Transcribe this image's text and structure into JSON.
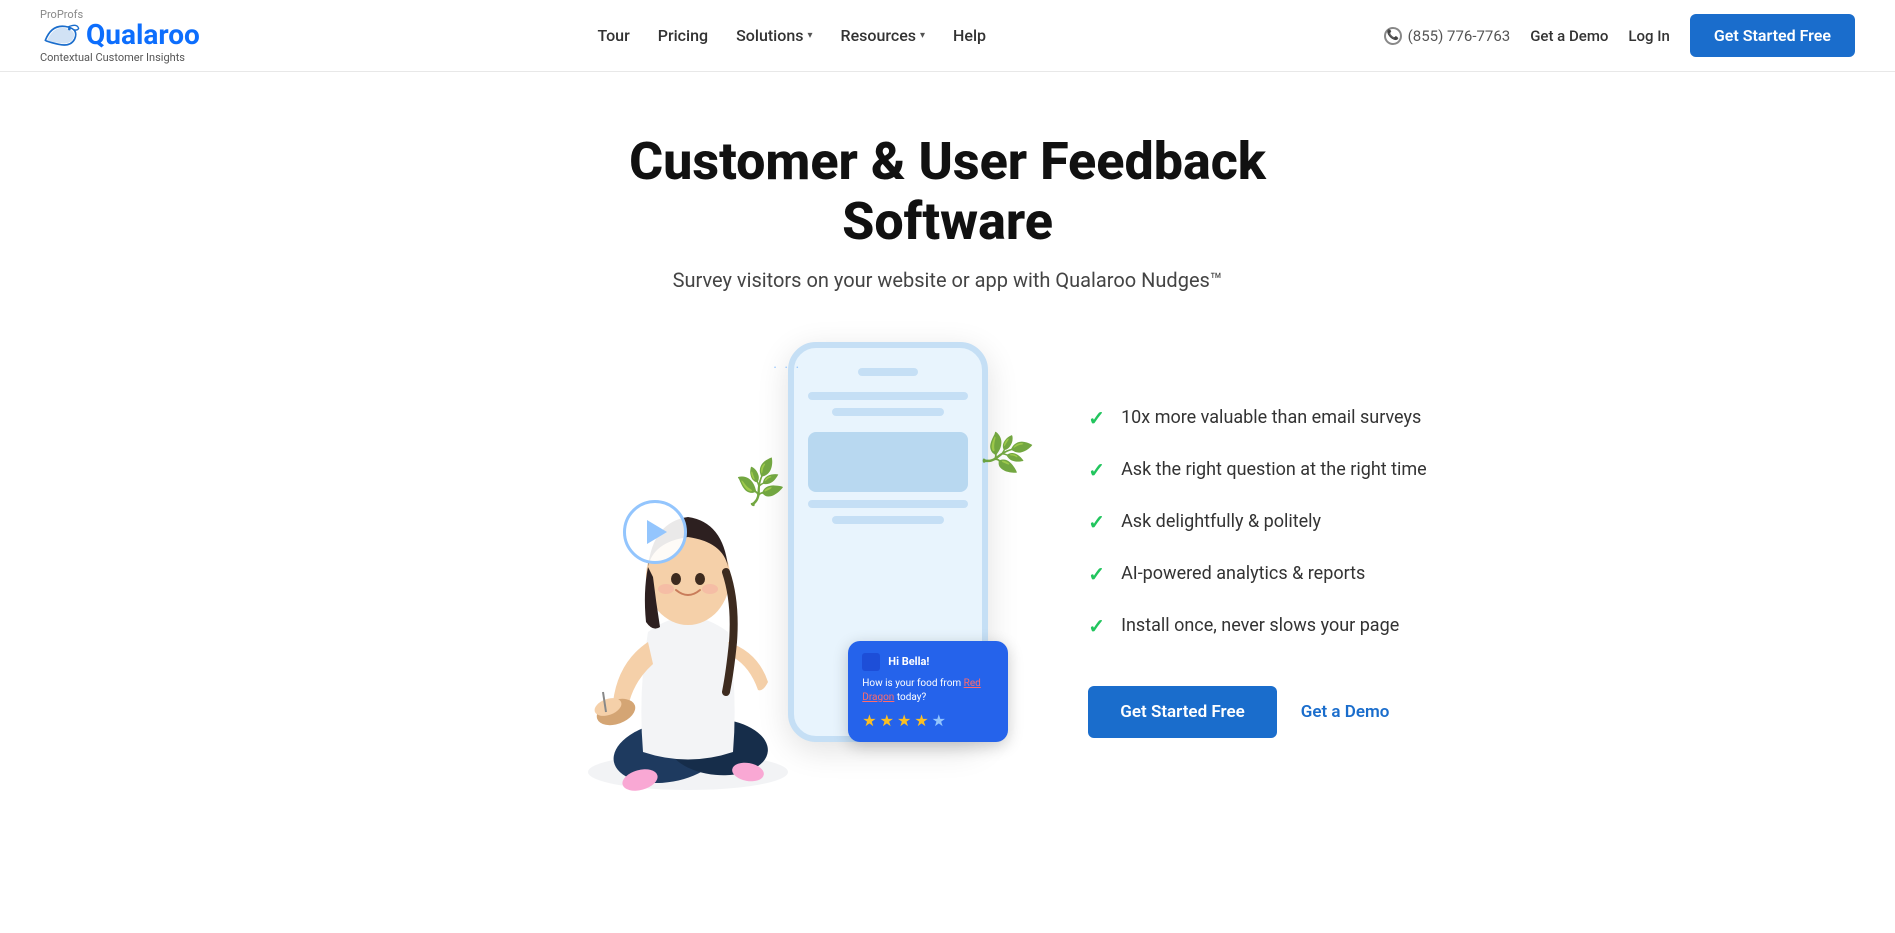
{
  "brand": {
    "proprofs_label": "ProProfs",
    "wordmark": "Qualaroo",
    "tagline": "Contextual Customer Insights"
  },
  "nav": {
    "tour_label": "Tour",
    "pricing_label": "Pricing",
    "solutions_label": "Solutions",
    "resources_label": "Resources",
    "help_label": "Help",
    "phone": "(855) 776-7763",
    "get_demo_label": "Get a Demo",
    "login_label": "Log In",
    "get_started_label": "Get Started Free"
  },
  "hero": {
    "title": "Customer & User Feedback Software",
    "subtitle": "Survey visitors on your website or app with Qualaroo Nudges™"
  },
  "nudge_card": {
    "hi": "Hi Bella!",
    "question": "How is your food from ",
    "question2": "Red Dragon",
    "question3": " today?"
  },
  "features": [
    {
      "text": "10x more valuable than email surveys"
    },
    {
      "text": "Ask the right question at the right time"
    },
    {
      "text": "Ask delightfully & politely"
    },
    {
      "text": "AI-powered analytics & reports"
    },
    {
      "text": "Install once, never slows your page"
    }
  ],
  "cta": {
    "get_started_label": "Get Started Free",
    "get_demo_label": "Get a Demo"
  },
  "colors": {
    "accent": "#1a6dcc",
    "check": "#22c55e",
    "nudge_bg": "#2563eb"
  }
}
